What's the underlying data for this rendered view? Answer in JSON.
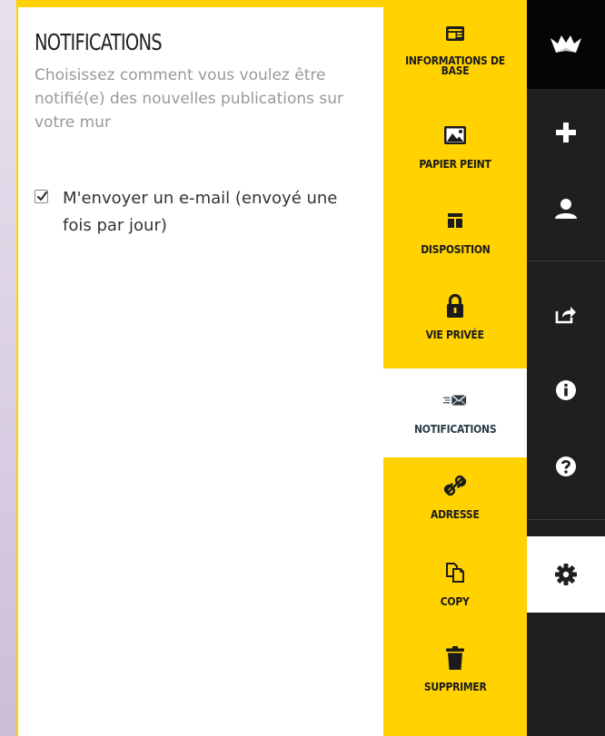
{
  "panel": {
    "title": "NOTIFICATIONS",
    "description": "Choisissez comment vous voulez être notifié(e) des nouvelles publications sur votre mur",
    "email_option": {
      "checked": true,
      "label": "M'envoyer un e-mail (envoyé une fois par jour)"
    }
  },
  "tabs": [
    {
      "label": "INFORMATIONS DE BASE",
      "icon": "info-card-icon"
    },
    {
      "label": "PAPIER PEINT",
      "icon": "image-icon"
    },
    {
      "label": "DISPOSITION",
      "icon": "layout-icon"
    },
    {
      "label": "VIE PRIVÉE",
      "icon": "lock-icon"
    },
    {
      "label": "NOTIFICATIONS",
      "icon": "envelope-icon",
      "active": true
    },
    {
      "label": "ADRESSE",
      "icon": "link-icon"
    },
    {
      "label": "COPY",
      "icon": "copy-icon"
    },
    {
      "label": "SUPPRIMER",
      "icon": "trash-icon"
    }
  ],
  "sidebar": {
    "logo": "padlet-logo-icon",
    "buttons": [
      "plus-icon",
      "user-icon",
      "share-icon",
      "info-icon",
      "help-icon",
      "gear-icon"
    ],
    "active": "gear-icon"
  },
  "colors": {
    "accent_yellow": "#ffd200",
    "sidebar_dark": "#1f1f1f",
    "sidebar_top": "#050505",
    "title_text": "#222222",
    "muted_text": "#999999"
  }
}
